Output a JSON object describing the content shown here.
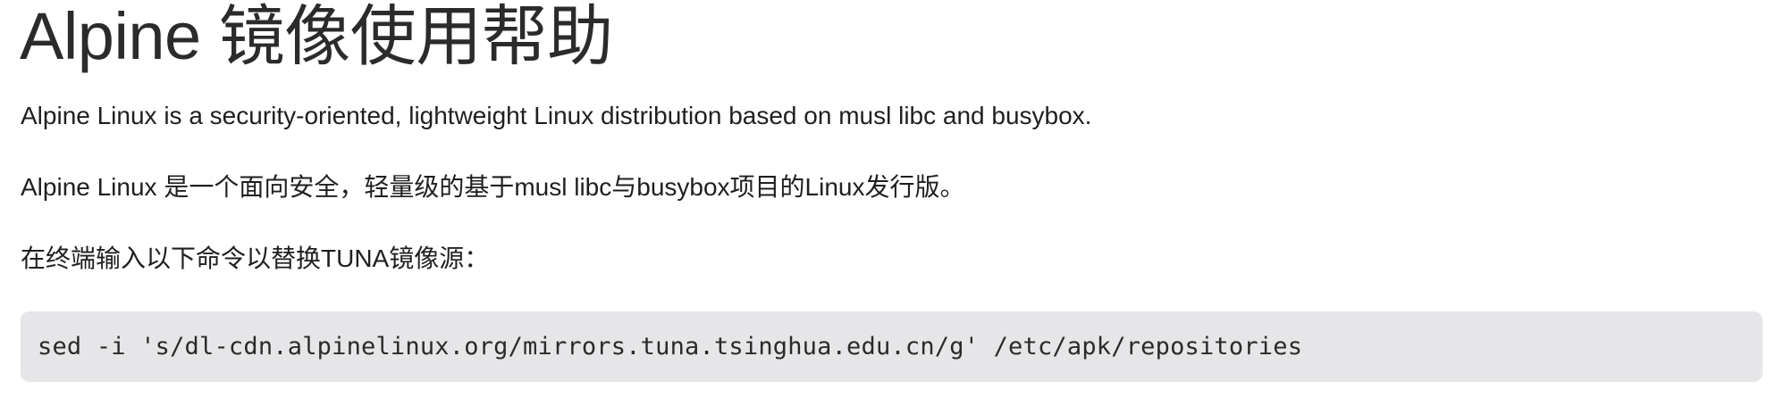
{
  "page": {
    "title": "Alpine 镜像使用帮助",
    "paragraphs": [
      "Alpine Linux is a security-oriented, lightweight Linux distribution based on musl libc and busybox.",
      "Alpine Linux 是一个面向安全，轻量级的基于musl libc与busybox项目的Linux发行版。",
      "在终端输入以下命令以替换TUNA镜像源："
    ],
    "code": "sed -i 's/dl-cdn.alpinelinux.org/mirrors.tuna.tsinghua.edu.cn/g' /etc/apk/repositories"
  },
  "colors": {
    "text": "#1f1f1f",
    "code_background": "#e6e6e8"
  }
}
